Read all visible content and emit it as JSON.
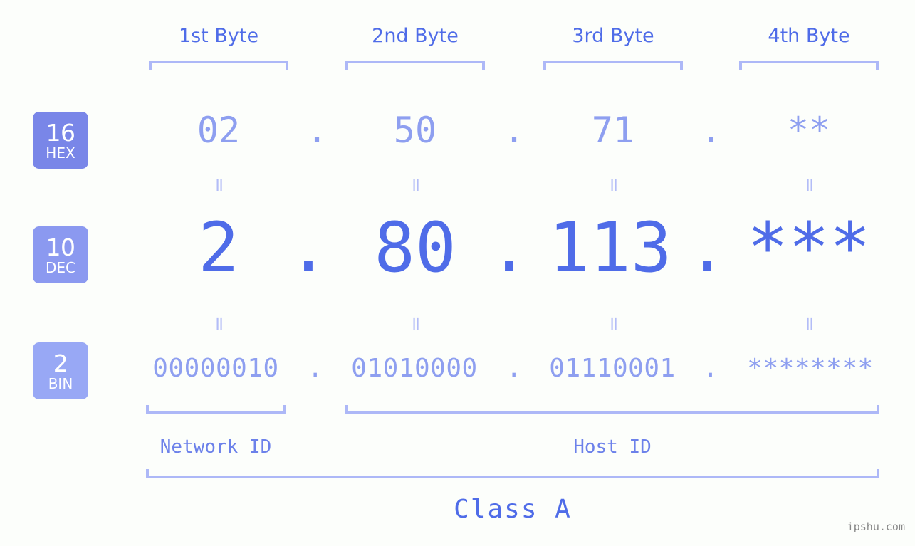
{
  "meta": {
    "watermark": "ipshu.com",
    "background_color": "#fcfefb",
    "accent_strong": "#4f6ce8",
    "accent_light": "#8e9ff0",
    "bracket_color": "#adb8f7"
  },
  "headers": {
    "bytes": [
      {
        "label": "1st Byte"
      },
      {
        "label": "2nd Byte"
      },
      {
        "label": "3rd Byte"
      },
      {
        "label": "4th Byte"
      }
    ]
  },
  "bases": [
    {
      "num": "16",
      "sub": "HEX",
      "color": "#7986e8"
    },
    {
      "num": "10",
      "sub": "DEC",
      "color": "#8b99f0"
    },
    {
      "num": "2",
      "sub": "BIN",
      "color": "#98a8f5"
    }
  ],
  "rows": {
    "hex": {
      "base_num": "16",
      "base_sub": "HEX",
      "values": [
        "02",
        "50",
        "71",
        "**"
      ],
      "separator": "."
    },
    "dec": {
      "base_num": "10",
      "base_sub": "DEC",
      "values": [
        "2",
        "80",
        "113",
        "***"
      ],
      "separator": "."
    },
    "bin": {
      "base_num": "2",
      "base_sub": "BIN",
      "values": [
        "00000010",
        "01010000",
        "01110001",
        "********"
      ],
      "separator": "."
    }
  },
  "equals_symbol": "=",
  "footer": {
    "network_id": "Network ID",
    "host_id": "Host ID",
    "class": "Class A"
  }
}
